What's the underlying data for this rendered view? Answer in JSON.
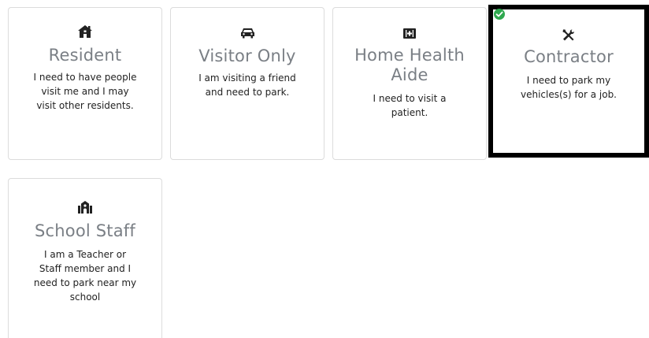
{
  "cards": [
    {
      "id": "resident",
      "icon": "house-icon",
      "title": "Resident",
      "description_lines": [
        "I need to have people",
        "visit me and I may",
        "visit other residents."
      ],
      "selected": false
    },
    {
      "id": "visitor-only",
      "icon": "car-icon",
      "title": "Visitor Only",
      "description_lines": [
        "I am visiting a friend",
        "and need to park."
      ],
      "selected": false
    },
    {
      "id": "home-health-aide",
      "icon": "medkit-icon",
      "title_lines": [
        "Home Health",
        "Aide"
      ],
      "description_lines": [
        "I need to visit a",
        "patient."
      ],
      "selected": false
    },
    {
      "id": "contractor",
      "icon": "tools-icon",
      "title": "Contractor",
      "description_lines": [
        "I need to park my",
        "vehicles(s) for a job."
      ],
      "selected": true
    },
    {
      "id": "school-staff",
      "icon": "school-icon",
      "title": "School Staff",
      "description_lines": [
        "I am a Teacher or",
        "Staff member and I",
        "need to park near my",
        "school"
      ],
      "selected": false
    }
  ],
  "colors": {
    "title": "#7a7f85",
    "text": "#222222",
    "card_border": "#dcdcdc",
    "selected_border": "#000000",
    "check": "#2fa84f"
  }
}
